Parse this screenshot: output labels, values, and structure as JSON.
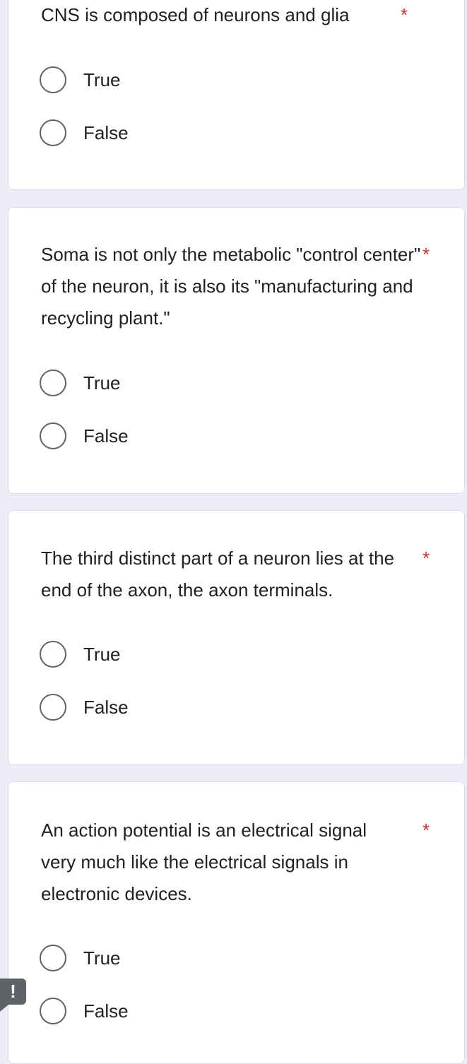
{
  "questions": [
    {
      "title": "CNS is composed of neurons and glia",
      "required": "*",
      "options": [
        "True",
        "False"
      ]
    },
    {
      "title": "Soma is not only the metabolic \"control center\" of the neuron, it is also its \"manufacturing and recycling plant.\"",
      "required": "*",
      "options": [
        "True",
        "False"
      ]
    },
    {
      "title": "The third distinct part of a neuron lies at the end of the axon, the axon terminals.",
      "required": "*",
      "options": [
        "True",
        "False"
      ]
    },
    {
      "title": "An action potential is an electrical signal very much like the electrical signals in electronic devices.",
      "required": "*",
      "options": [
        "True",
        "False"
      ]
    }
  ],
  "alert_badge": "!",
  "colors": {
    "page_background": "#f0ebf8",
    "card_background": "#ffffff",
    "required_asterisk": "#d93025",
    "radio_border": "#5f6368"
  }
}
